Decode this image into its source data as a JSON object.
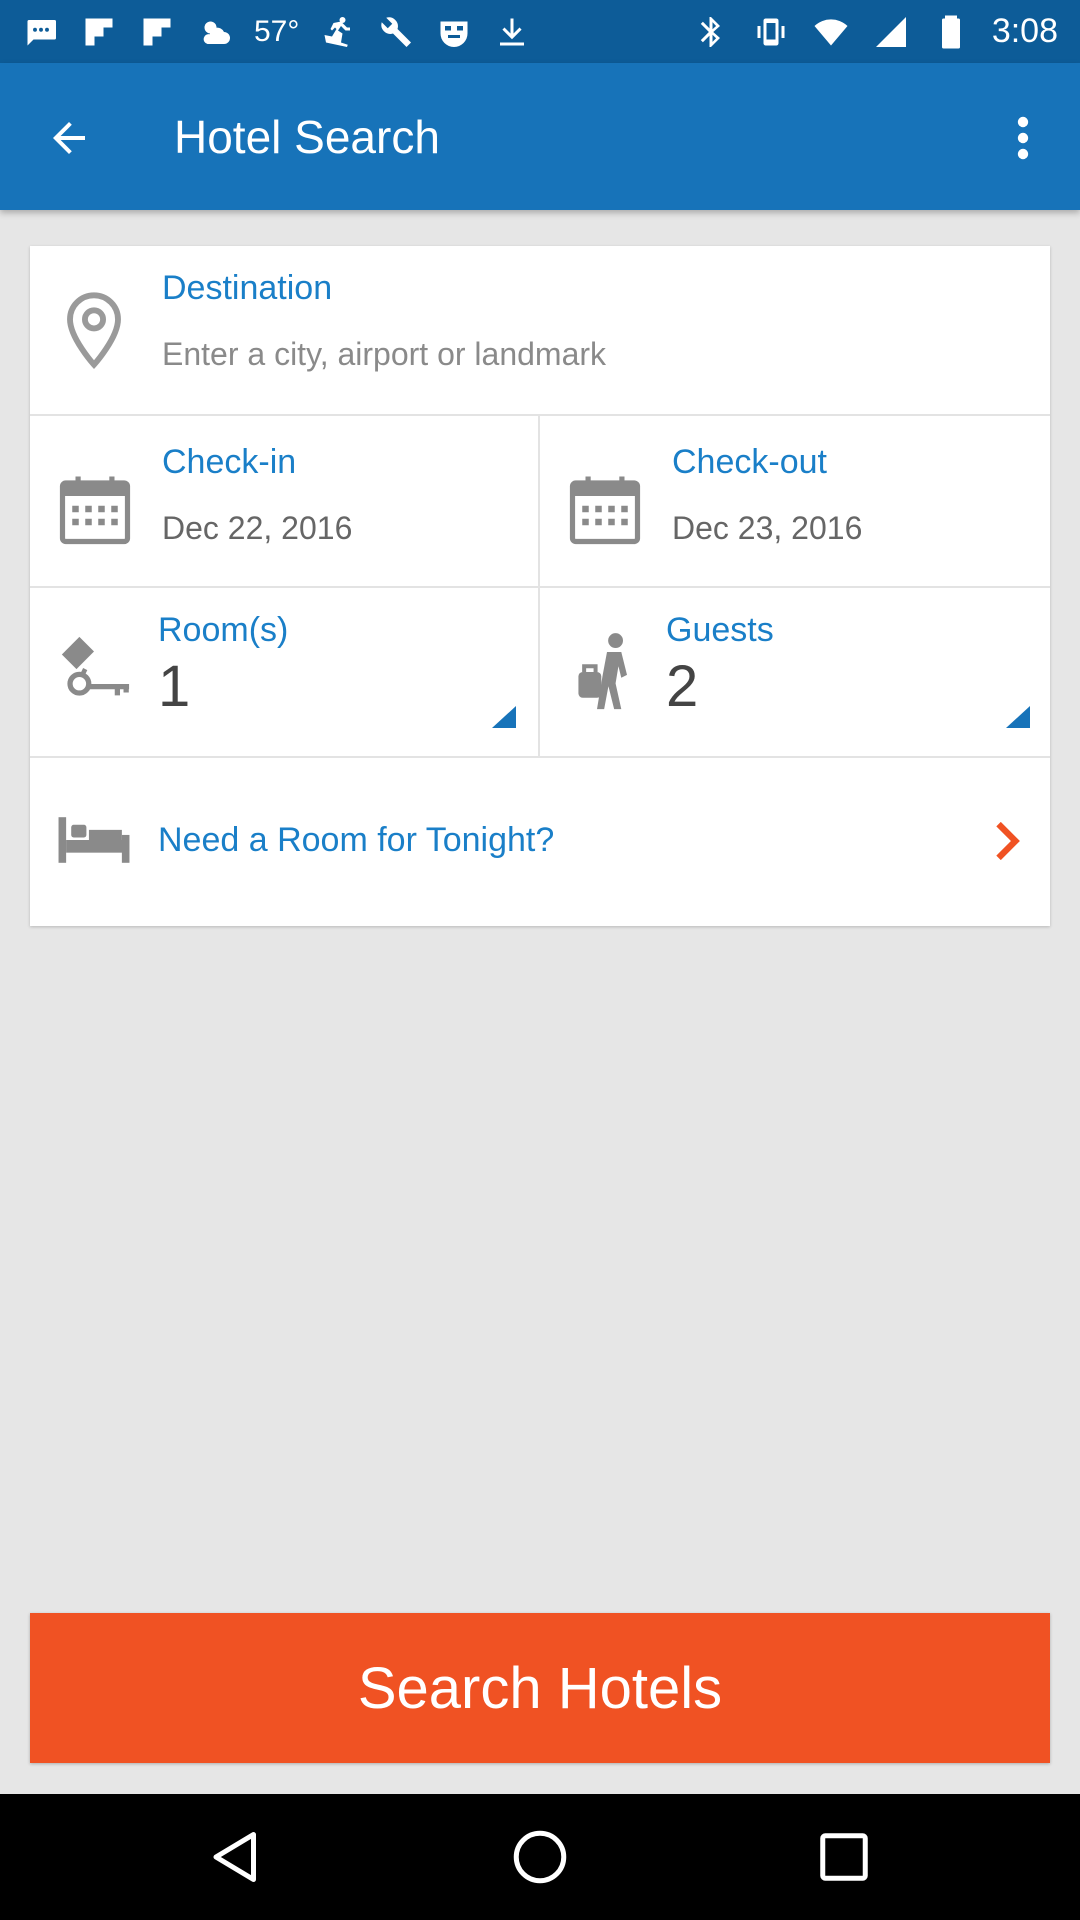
{
  "status_bar": {
    "temperature": "57°",
    "time": "3:08",
    "icons": [
      "message-icon",
      "flipboard-icon",
      "flipboard-icon",
      "weather-icon",
      "skiing-icon",
      "tools-icon",
      "mask-icon",
      "download-icon",
      "bluetooth-icon",
      "vibrate-icon",
      "wifi-icon",
      "signal-icon",
      "battery-icon"
    ]
  },
  "app_bar": {
    "title": "Hotel Search",
    "back_icon": "arrow-back-icon",
    "menu_icon": "more-vertical-icon"
  },
  "form": {
    "destination": {
      "label": "Destination",
      "placeholder": "Enter a city, airport or landmark",
      "icon": "location-pin-icon"
    },
    "check_in": {
      "label": "Check-in",
      "value": "Dec 22, 2016",
      "icon": "calendar-icon"
    },
    "check_out": {
      "label": "Check-out",
      "value": "Dec 23, 2016",
      "icon": "calendar-icon"
    },
    "rooms": {
      "label": "Room(s)",
      "value": "1",
      "icon": "room-key-icon"
    },
    "guests": {
      "label": "Guests",
      "value": "2",
      "icon": "traveler-icon"
    },
    "tonight": {
      "label": "Need a Room for Tonight?",
      "icon": "bed-icon",
      "chevron_icon": "chevron-right-icon"
    }
  },
  "search_button": {
    "label": "Search Hotels"
  },
  "colors": {
    "status_bar": "#0d5c98",
    "app_bar": "#1773b9",
    "accent_text": "#1a7fc8",
    "search_button": "#f05223",
    "chevron": "#f05223"
  }
}
